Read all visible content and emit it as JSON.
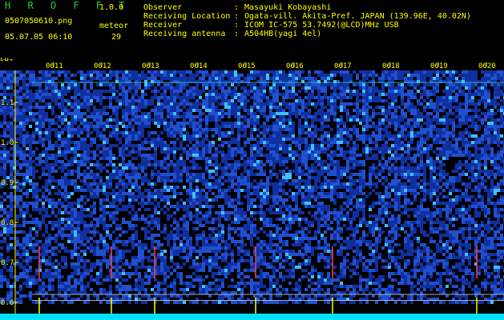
{
  "header": {
    "app_title": "H R O F F T",
    "version": "1.0.0",
    "filename": "0507050610.png",
    "datetime": "05.07.05 06:10",
    "meteor_label": "meteor",
    "meteor_count": "29"
  },
  "info": {
    "rows": [
      {
        "key": "Observer",
        "value": "Masayuki Kobayashi"
      },
      {
        "key": "Receiving Location",
        "value": "Ogata-vill. Akita-Pref. JAPAN (139.96E, 40.02N)"
      },
      {
        "key": "Receiver",
        "value": "ICOM IC-575 53.7492(@LCD)MHz USB"
      },
      {
        "key": "Receiving antenna",
        "value": "A504HB(yagi 4el)"
      }
    ]
  },
  "chart_data": {
    "type": "heatmap",
    "ylabel": "kHz",
    "y_ticks": [
      "1.1",
      "1.0",
      "0.9",
      "0.8",
      "0.7",
      "0.6"
    ],
    "x_ticks": [
      "0611",
      "0612",
      "0613",
      "0614",
      "0615",
      "0616",
      "0617",
      "0618",
      "0619",
      "0620"
    ],
    "yrange_khz": [
      0.58,
      1.18
    ],
    "reference_lines_khz": [
      1.15,
      0.62,
      0.605
    ],
    "colors": {
      "background": "#000000",
      "noise_low": "#1030a0",
      "noise_mid": "#2050d0",
      "noise_high": "#40c0ff",
      "axis": "#ffff00",
      "text": "#ffff00",
      "baseline": "#00e0ff"
    },
    "meteor_echo_times": [
      "0610.7",
      "0612.2",
      "0613.1",
      "0615.2",
      "0616.8",
      "0619.8"
    ]
  }
}
